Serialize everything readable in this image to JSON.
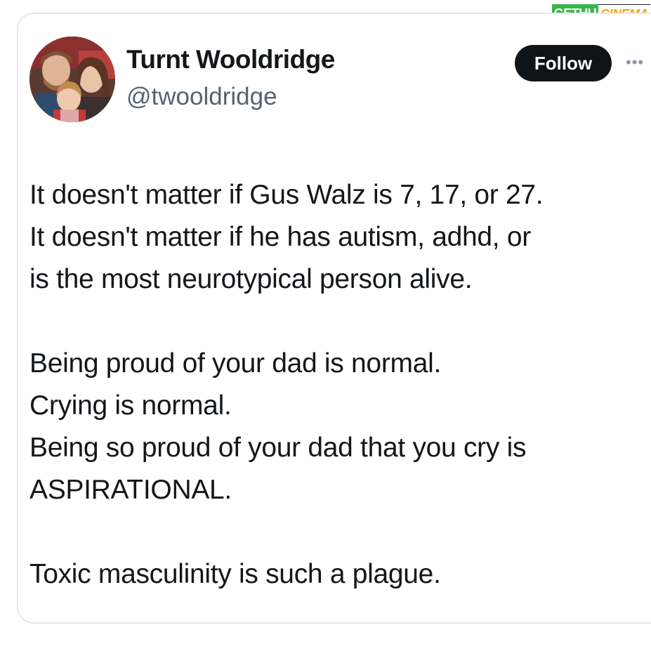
{
  "watermark": {
    "left": "GETHU",
    "right": "CINEMA"
  },
  "tweet": {
    "author": {
      "display_name": "Turnt Wooldridge",
      "handle": "@twooldridge",
      "avatar_icon": "profile-photo"
    },
    "follow_label": "Follow",
    "more_icon": "more-horizontal-icon",
    "paragraphs": [
      [
        "It doesn't matter if Gus Walz is 7, 17, or 27.",
        "It doesn't matter if he has autism, adhd, or",
        "is the most neurotypical person alive."
      ],
      [
        "Being proud of your dad is normal.",
        "Crying is normal.",
        "Being so proud of your dad that you cry is",
        "ASPIRATIONAL."
      ],
      [
        "Toxic masculinity is such a plague."
      ]
    ]
  },
  "colors": {
    "text": "#14171a",
    "secondary": "#536471",
    "follow_bg": "#0f1419",
    "border": "#e7e9eb"
  }
}
